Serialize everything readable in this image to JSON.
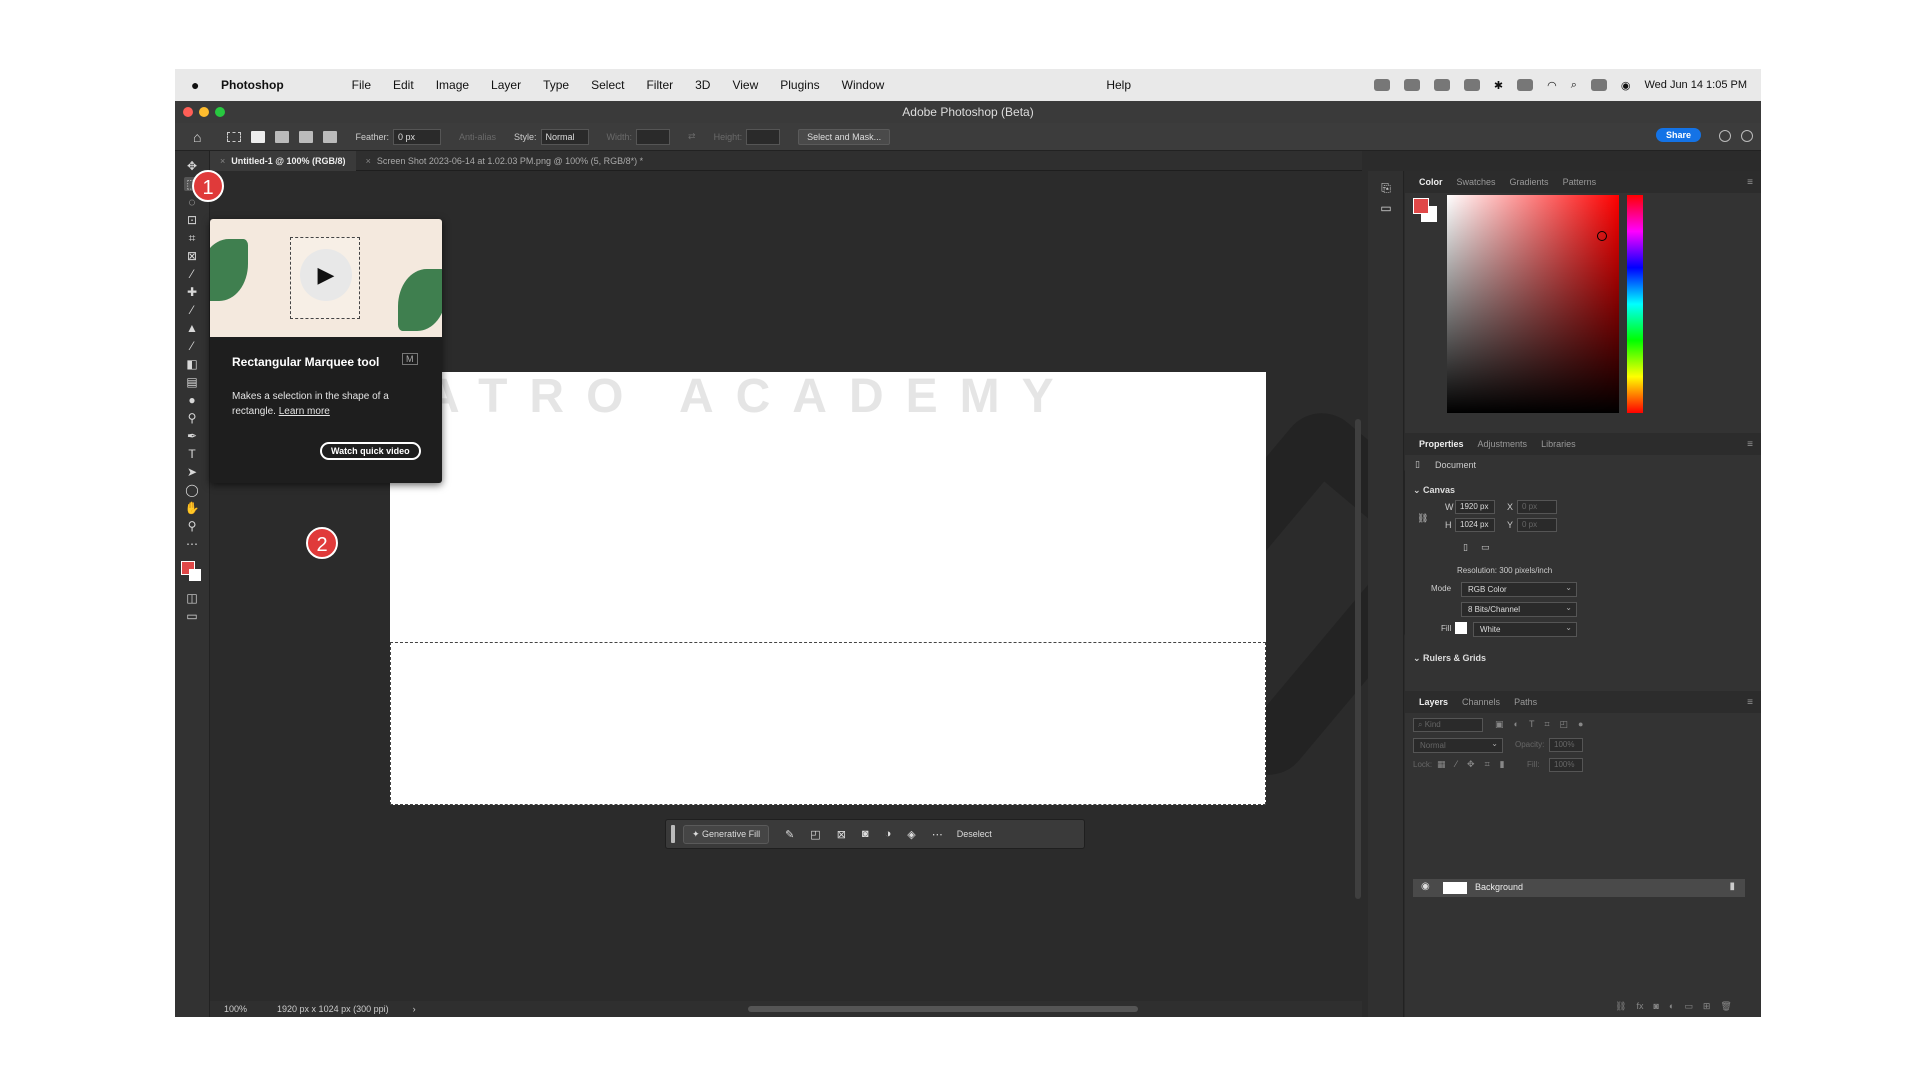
{
  "menubar": {
    "app": "Photoshop",
    "menus": [
      "File",
      "Edit",
      "Image",
      "Layer",
      "Type",
      "Select",
      "Filter",
      "3D",
      "View",
      "Plugins",
      "Window"
    ],
    "help": "Help",
    "clock": "Wed Jun 14  1:05 PM"
  },
  "window": {
    "title": "Adobe Photoshop (Beta)"
  },
  "options": {
    "feather_label": "Feather:",
    "feather_value": "0 px",
    "antialias_label": "Anti-alias",
    "style_label": "Style:",
    "style_value": "Normal",
    "width_label": "Width:",
    "height_label": "Height:",
    "select_mask": "Select and Mask...",
    "share": "Share"
  },
  "tabs": [
    {
      "label": "Untitled-1 @ 100% (RGB/8)"
    },
    {
      "label": "Screen Shot 2023-06-14 at 1.02.03 PM.png @ 100% (5, RGB/8*) *"
    }
  ],
  "tooltip": {
    "title": "Rectangular Marquee tool",
    "shortcut": "M",
    "description": "Makes a selection in the shape of a rectangle.",
    "link": "Learn more",
    "button": "Watch quick video"
  },
  "callouts": {
    "one": "1",
    "two": "2"
  },
  "watermark": {
    "text": "ATRO ACADEMY"
  },
  "contextbar": {
    "generative_fill": "Generative Fill",
    "deselect": "Deselect"
  },
  "status": {
    "zoom": "100%",
    "doc_info": "1920 px x 1024 px (300 ppi)"
  },
  "color_panel": {
    "tabs": [
      "Color",
      "Swatches",
      "Gradients",
      "Patterns"
    ],
    "fg_color": "#e04848",
    "bg_color": "#ffffff"
  },
  "properties": {
    "tabs": [
      "Properties",
      "Adjustments",
      "Libraries"
    ],
    "document_label": "Document",
    "canvas_label": "Canvas",
    "w_label": "W",
    "w_value": "1920 px",
    "h_label": "H",
    "h_value": "1024 px",
    "x_label": "X",
    "x_value": "0 px",
    "y_label": "Y",
    "y_value": "0 px",
    "resolution": "Resolution: 300 pixels/inch",
    "mode_label": "Mode",
    "mode_value": "RGB Color",
    "bits_value": "8 Bits/Channel",
    "fill_label": "Fill",
    "fill_value": "White",
    "rulers_label": "Rulers & Grids"
  },
  "layers": {
    "tabs": [
      "Layers",
      "Channels",
      "Paths"
    ],
    "kind_placeholder": "Kind",
    "blend": "Normal",
    "opacity_label": "Opacity:",
    "opacity_value": "100%",
    "lock_label": "Lock:",
    "fill_label": "Fill:",
    "fill_value": "100%",
    "layer_name": "Background"
  },
  "accent": "#1473e6"
}
